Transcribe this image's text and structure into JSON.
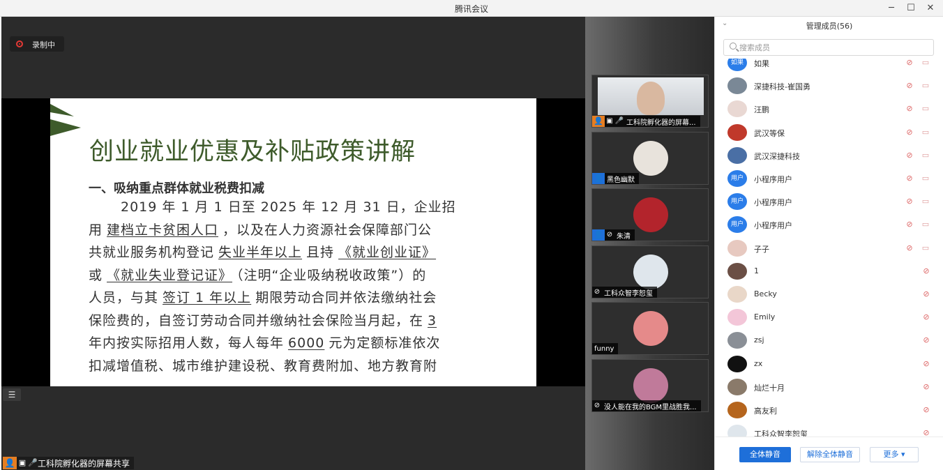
{
  "window": {
    "title": "腾讯会议",
    "controls": {
      "minimize": "─",
      "maximize": "☐",
      "close": "✕"
    }
  },
  "stage": {
    "recording_label": "录制中",
    "list_icon_glyph": "☰",
    "presenter_label": "工科院孵化器的屏幕共享",
    "slide": {
      "title": "创业就业优惠及补贴政策讲解",
      "subtitle": "一、吸纳重点群体就业税费扣减",
      "lines": [
        {
          "parts": [
            {
              "t": "2019 年 1 月 1 日至 2025 年 12 月 31 日，企业招"
            }
          ],
          "indent": true
        },
        {
          "parts": [
            {
              "t": "用"
            },
            {
              "t": "建档立卡贫困人口",
              "u": true
            },
            {
              "t": "，以及在人力资源社会保障部门公"
            }
          ]
        },
        {
          "parts": [
            {
              "t": "共就业服务机构登记"
            },
            {
              "t": "失业半年以上",
              "u": true
            },
            {
              "t": "且持"
            },
            {
              "t": "《就业创业证》",
              "u": true
            }
          ]
        },
        {
          "parts": [
            {
              "t": "或"
            },
            {
              "t": "《就业失业登记证》",
              "u": true
            },
            {
              "t": "（注明“企业吸纳税收政策”）的"
            }
          ]
        },
        {
          "parts": [
            {
              "t": "人员，与其"
            },
            {
              "t": "签订 1 年以上",
              "u": true
            },
            {
              "t": "期限劳动合同并依法缴纳社会"
            }
          ]
        },
        {
          "parts": [
            {
              "t": "保险费的，自签订劳动合同并缴纳社会保险当月起，在"
            },
            {
              "t": "3",
              "u": true
            }
          ]
        },
        {
          "parts": [
            {
              "t": "年内按实际招用人数，每人每年"
            },
            {
              "t": "6000",
              "u": true
            },
            {
              "t": "元为定额标准依次"
            }
          ]
        },
        {
          "parts": [
            {
              "t": "扣减增值税、城市维护建设税、教育费附加、地方教育附"
            }
          ]
        }
      ]
    }
  },
  "strip": {
    "tiles": [
      {
        "name": "工科院孵化器的屏幕...",
        "type": "camera",
        "host": true
      },
      {
        "name": "黑色幽默",
        "type": "avatar",
        "avatar_color": "#e8e3dc",
        "host": false
      },
      {
        "name": "朱清",
        "type": "avatar",
        "avatar_color": "#b3242c",
        "host": false,
        "muted": true
      },
      {
        "name": "工科众智李恕玺",
        "type": "avatar",
        "avatar_color": "#dfe6ec",
        "host": false,
        "muted_only": true
      },
      {
        "name": "funny",
        "type": "avatar",
        "avatar_color": "#e58a8a",
        "host": false,
        "plain": true
      },
      {
        "name": "没人能在我的BGM里战胜我...",
        "type": "avatar",
        "avatar_color": "#c07a9a",
        "host": false,
        "muted_only": true
      }
    ]
  },
  "panel": {
    "title": "管理成员(56)",
    "search_placeholder": "搜索成员",
    "members": [
      {
        "name": "如果",
        "avatar_text": "如果",
        "avatar_color": "#2b7de9",
        "cam": true
      },
      {
        "name": "深捷科技-崔国勇",
        "avatar_text": "",
        "avatar_color": "#7a8896",
        "cam": true
      },
      {
        "name": "汪鹏",
        "avatar_text": "",
        "avatar_color": "#e9d8d3",
        "cam": true
      },
      {
        "name": "武汉等保",
        "avatar_text": "",
        "avatar_color": "#c0392b",
        "cam": true
      },
      {
        "name": "武汉深捷科技",
        "avatar_text": "",
        "avatar_color": "#4a6fa5",
        "cam": true
      },
      {
        "name": "小程序用户",
        "avatar_text": "用户",
        "avatar_color": "#2b7de9",
        "cam": true
      },
      {
        "name": "小程序用户",
        "avatar_text": "用户",
        "avatar_color": "#2b7de9",
        "cam": true
      },
      {
        "name": "小程序用户",
        "avatar_text": "用户",
        "avatar_color": "#2b7de9",
        "cam": true
      },
      {
        "name": "子子",
        "avatar_text": "",
        "avatar_color": "#e7c9c0",
        "cam": true
      },
      {
        "name": "1",
        "avatar_text": "",
        "avatar_color": "#6b4f45",
        "cam": false
      },
      {
        "name": "Becky",
        "avatar_text": "",
        "avatar_color": "#e9d7c8",
        "cam": false
      },
      {
        "name": "Emily",
        "avatar_text": "",
        "avatar_color": "#f3c6d8",
        "cam": false
      },
      {
        "name": "zsj",
        "avatar_text": "",
        "avatar_color": "#8a8f96",
        "cam": false
      },
      {
        "name": "zx",
        "avatar_text": "",
        "avatar_color": "#111111",
        "cam": false
      },
      {
        "name": "灿烂十月",
        "avatar_text": "",
        "avatar_color": "#8a7a6a",
        "cam": false
      },
      {
        "name": "高友利",
        "avatar_text": "",
        "avatar_color": "#b5651d",
        "cam": false
      },
      {
        "name": "工科众智李恕玺",
        "avatar_text": "",
        "avatar_color": "#dfe6ec",
        "cam": false
      }
    ],
    "buttons": {
      "mute_all": "全体静音",
      "unmute_all": "解除全体静音",
      "more": "更多 ▾"
    }
  },
  "colors": {
    "brand_blue": "#1e6fd9",
    "host_orange": "#e67e22",
    "slide_title_green": "#3e5b2b",
    "record_red": "#e53935"
  },
  "icons": {
    "mic_off": "⊘",
    "cam_off": "▭",
    "mic": "🎤"
  }
}
